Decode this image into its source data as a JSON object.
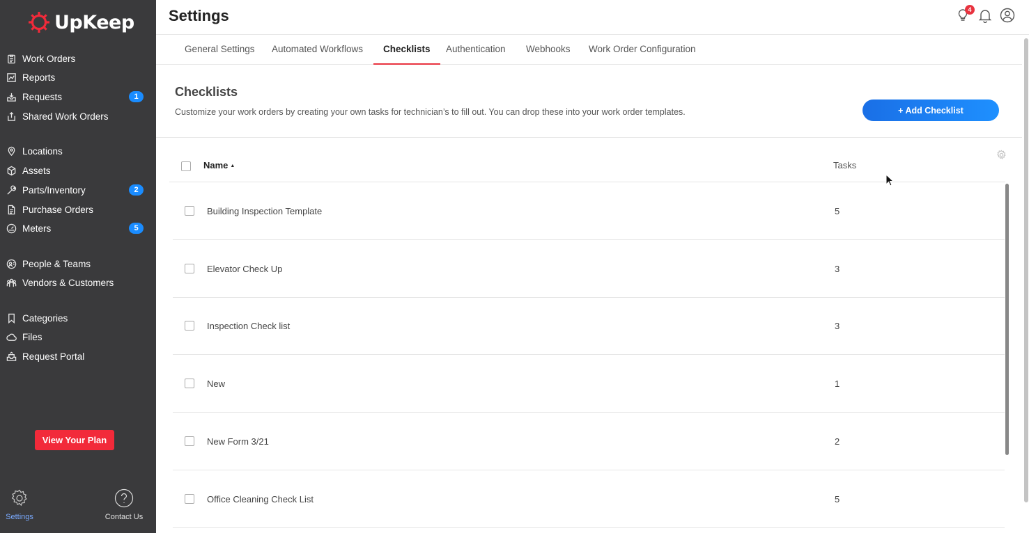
{
  "brand": {
    "name": "UpKeep",
    "accent": "#f22a3a",
    "primary": "#1e7cf2"
  },
  "sidebar": {
    "items": [
      {
        "label": "Work Orders",
        "icon": "clipboard-icon"
      },
      {
        "label": "Reports",
        "icon": "chart-icon"
      },
      {
        "label": "Requests",
        "icon": "inbox-icon",
        "badge": "1"
      },
      {
        "label": "Shared Work Orders",
        "icon": "share-icon"
      },
      {
        "label": "Locations",
        "icon": "pin-icon"
      },
      {
        "label": "Assets",
        "icon": "cube-icon"
      },
      {
        "label": "Parts/Inventory",
        "icon": "wrench-icon",
        "badge": "2"
      },
      {
        "label": "Purchase Orders",
        "icon": "document-icon"
      },
      {
        "label": "Meters",
        "icon": "gauge-icon",
        "badge": "5"
      },
      {
        "label": "People & Teams",
        "icon": "people-icon"
      },
      {
        "label": "Vendors & Customers",
        "icon": "group-icon"
      },
      {
        "label": "Categories",
        "icon": "bookmark-icon"
      },
      {
        "label": "Files",
        "icon": "cloud-icon"
      },
      {
        "label": "Request Portal",
        "icon": "portal-icon"
      }
    ],
    "plan_button": "View Your Plan",
    "settings_label": "Settings",
    "contact_label": "Contact Us"
  },
  "header": {
    "title": "Settings",
    "notification_count": "4"
  },
  "tabs": [
    {
      "label": "General Settings"
    },
    {
      "label": "Automated Workflows"
    },
    {
      "label": "Checklists",
      "active": true
    },
    {
      "label": "Authentication"
    },
    {
      "label": "Webhooks"
    },
    {
      "label": "Work Order Configuration"
    }
  ],
  "section": {
    "title": "Checklists",
    "description": "Customize your work orders by creating your own tasks for technician’s to fill out. You can drop these into your work order templates.",
    "add_button": "+ Add Checklist"
  },
  "table": {
    "columns": {
      "name": "Name",
      "tasks": "Tasks"
    },
    "rows": [
      {
        "name": "Building Inspection Template",
        "tasks": "5"
      },
      {
        "name": "Elevator Check Up",
        "tasks": "3"
      },
      {
        "name": "Inspection Check list",
        "tasks": "3"
      },
      {
        "name": "New",
        "tasks": "1"
      },
      {
        "name": "New Form 3/21",
        "tasks": "2"
      },
      {
        "name": "Office Cleaning Check List",
        "tasks": "5"
      }
    ]
  }
}
